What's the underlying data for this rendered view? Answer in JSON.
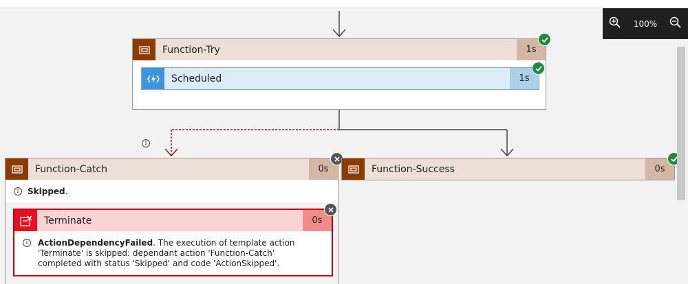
{
  "zoom": {
    "level": "100%",
    "zoom_in_icon": "zoom-in-icon",
    "zoom_out_icon": "zoom-out-icon"
  },
  "try_scope": {
    "title": "Function-Try",
    "duration": "1s",
    "status": "succeeded",
    "color": "#8c3b00"
  },
  "scheduled": {
    "title": "Scheduled",
    "duration": "1s",
    "status": "succeeded",
    "color": "#3a96dd"
  },
  "catch_scope": {
    "title": "Function-Catch",
    "duration": "0s",
    "status": "skipped",
    "status_label": "Skipped",
    "status_suffix": "."
  },
  "success_scope": {
    "title": "Function-Success",
    "duration": "0s",
    "status": "succeeded"
  },
  "terminate": {
    "title": "Terminate",
    "duration": "0s",
    "status": "skipped",
    "error_code": "ActionDependencyFailed",
    "error_message": ". The execution of template action 'Terminate' is skipped: dependant action 'Function-Catch' completed with status 'Skipped' and code 'ActionSkipped'.",
    "color": "#e81123"
  }
}
